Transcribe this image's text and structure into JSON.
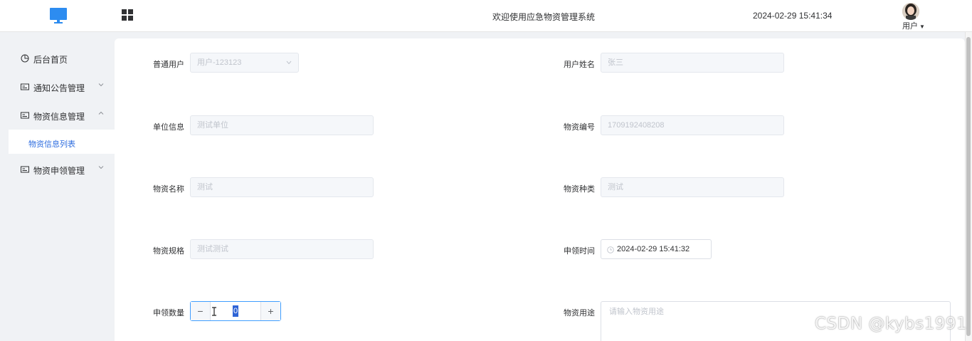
{
  "header": {
    "title": "欢迎使用应急物资管理系统",
    "datetime": "2024-02-29 15:41:34",
    "user_label": "用户",
    "logo_icon": "monitor-icon",
    "menu_toggle_icon": "grid-icon",
    "accent": "#2d8cf0"
  },
  "sidebar": {
    "items": [
      {
        "label": "后台首页",
        "icon": "pie-chart-icon"
      },
      {
        "label": "通知公告管理",
        "icon": "card-icon",
        "arrow": "chevron-down-icon"
      },
      {
        "label": "物资信息管理",
        "icon": "card-icon",
        "arrow": "chevron-up-icon"
      },
      {
        "label": "物资申领管理",
        "icon": "card-icon",
        "arrow": "chevron-down-icon"
      }
    ],
    "active_sub": {
      "label": "物资信息列表",
      "color": "#2d6cdf"
    }
  },
  "form": {
    "user_type": {
      "label": "普通用户",
      "value": "用户-123123"
    },
    "user_name": {
      "label": "用户姓名",
      "value": "张三"
    },
    "unit_info": {
      "label": "单位信息",
      "value": "测试单位"
    },
    "material_code": {
      "label": "物资编号",
      "value": "1709192408208"
    },
    "material_name": {
      "label": "物资名称",
      "value": "测试"
    },
    "material_kind": {
      "label": "物资种类",
      "value": "测试"
    },
    "material_spec": {
      "label": "物资规格",
      "value": "测试测试"
    },
    "claim_time": {
      "label": "申领时间",
      "value": "2024-02-29 15:41:32"
    },
    "claim_qty": {
      "label": "申领数量",
      "value": "0",
      "minus": "−",
      "plus": "+"
    },
    "material_use": {
      "label": "物资用途",
      "placeholder": "请输入物资用途"
    }
  },
  "watermark": "CSDN @kybs1991"
}
